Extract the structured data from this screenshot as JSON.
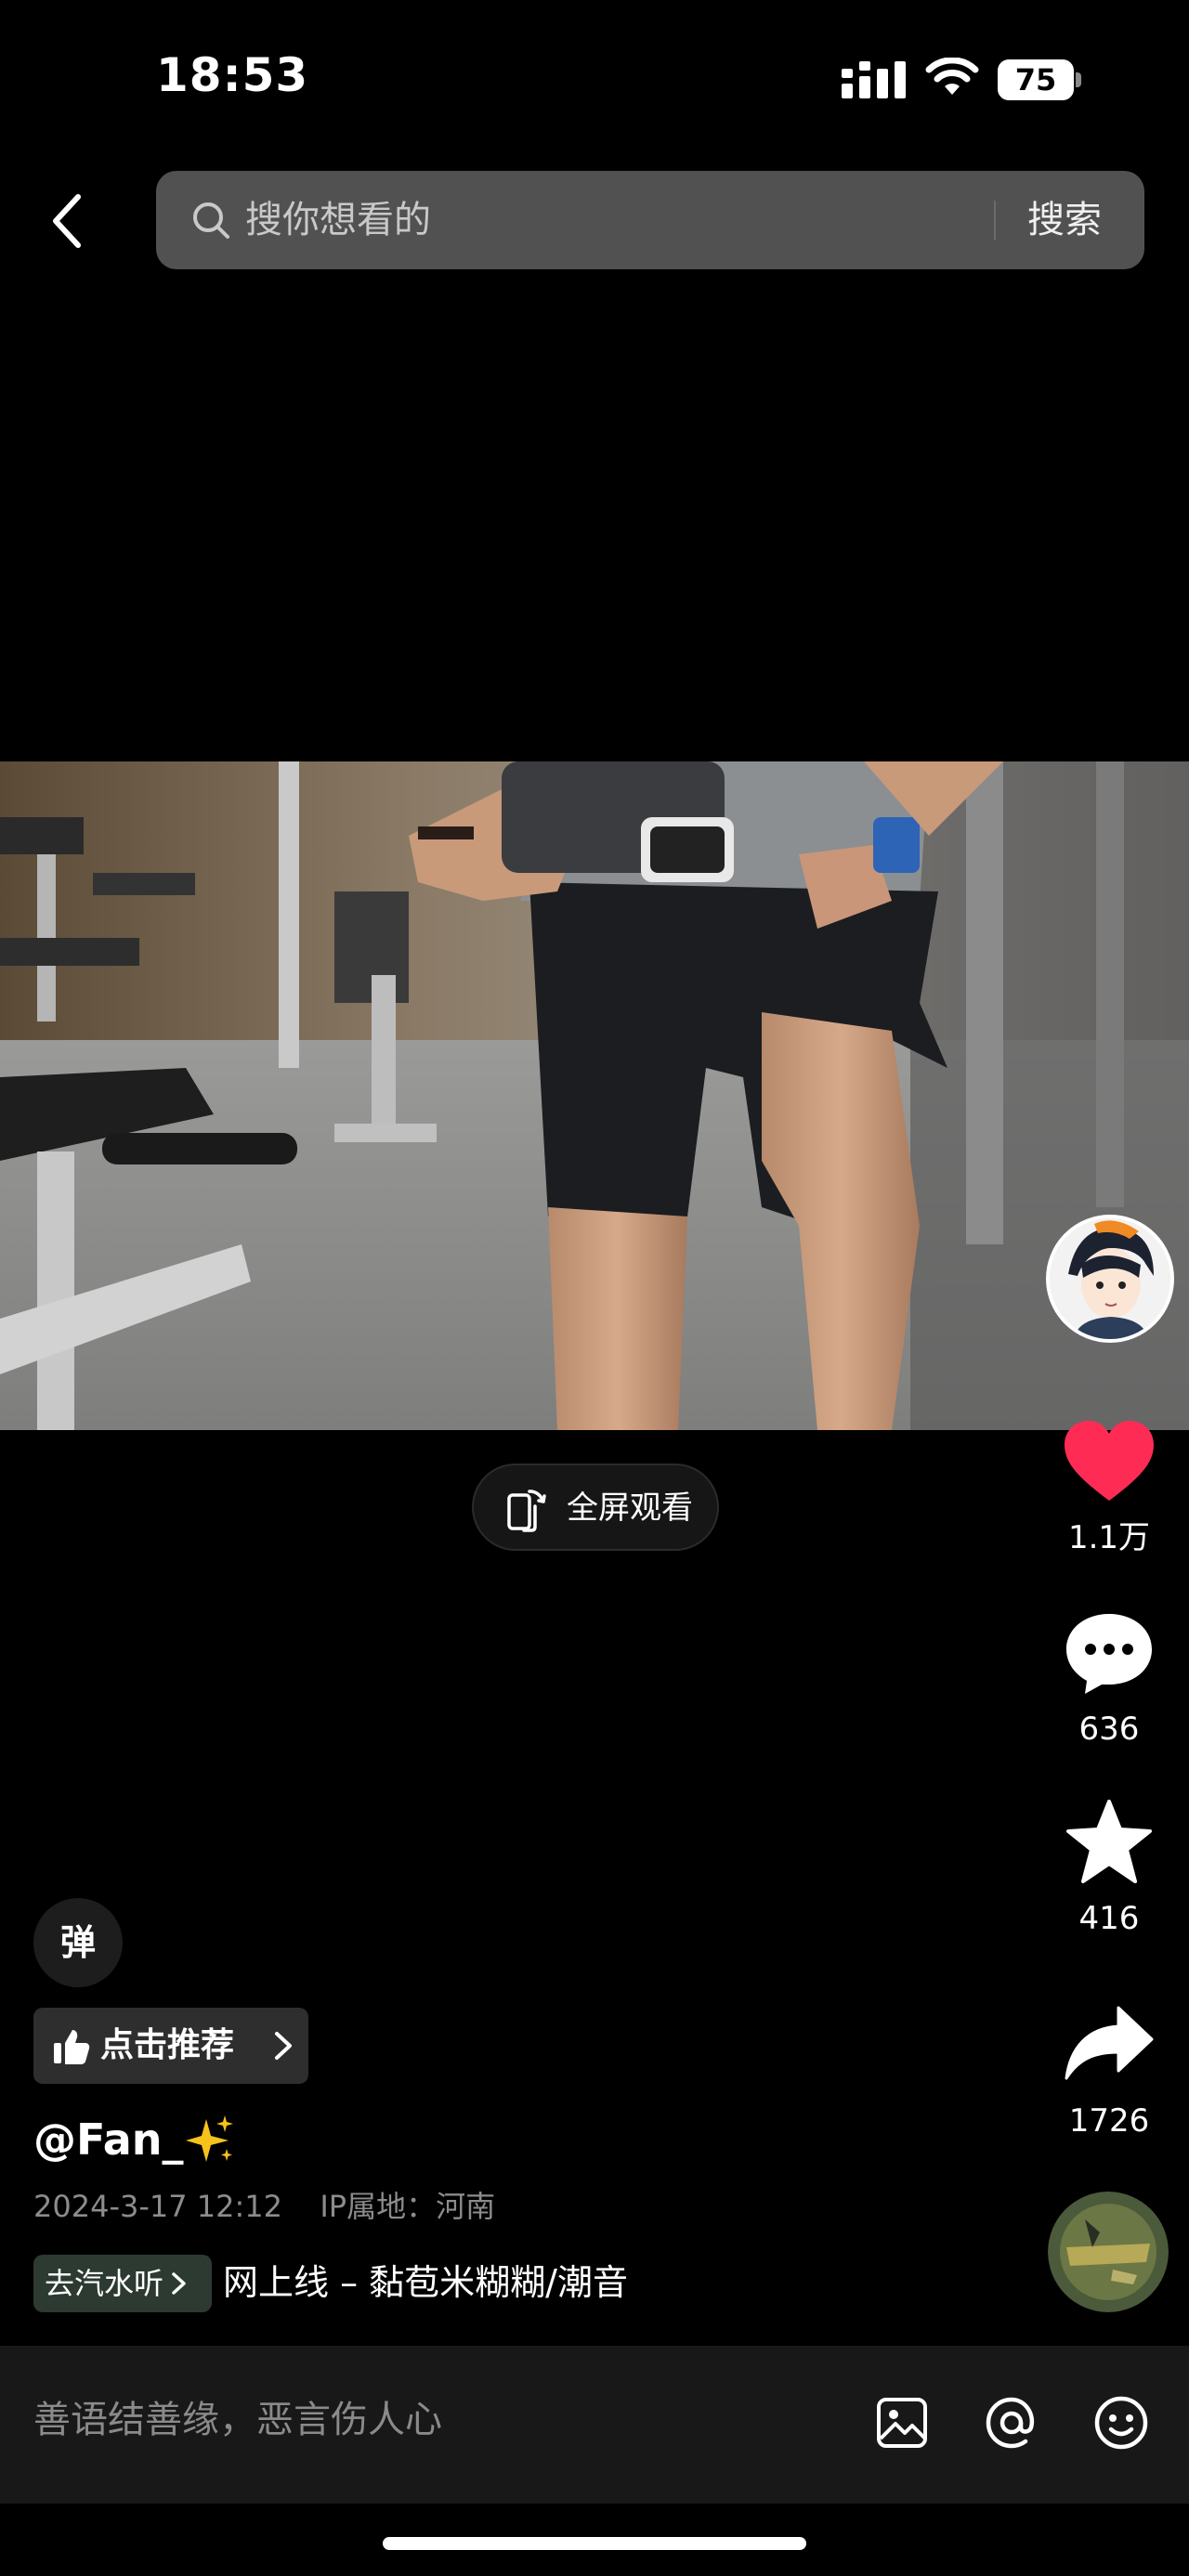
{
  "status_bar": {
    "time": "18:53",
    "battery": "75"
  },
  "header": {
    "search_placeholder": "搜你想看的",
    "search_button": "搜索"
  },
  "video": {
    "fullscreen_label": "全屏观看"
  },
  "actions": {
    "like_count": "1.1万",
    "comment_count": "636",
    "favorite_count": "416",
    "share_count": "1726"
  },
  "info": {
    "danmu_label": "弹",
    "recommend_label": "点击推荐",
    "author": "@Fan_",
    "author_emoji": "✨",
    "date": "2024-3-17 12:12",
    "ip_location": "IP属地：河南",
    "music_chip_label": "去汽水听",
    "music_title": "网上线 – 黏苞米糊糊/潮音"
  },
  "comment_bar": {
    "placeholder": "善语结善缘，恶言伤人心"
  },
  "colors": {
    "like": "#fe2c55",
    "background": "#000000",
    "search_box": "#515151",
    "comment_bar": "#181818"
  }
}
